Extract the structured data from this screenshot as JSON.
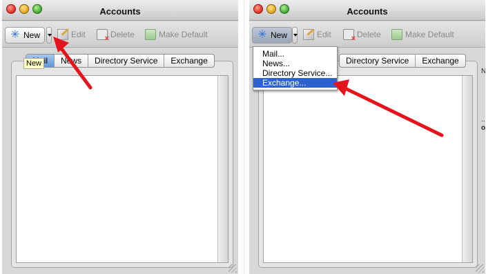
{
  "left": {
    "window_title": "Accounts",
    "toolbar": {
      "new": "New",
      "edit": "Edit",
      "delete": "Delete",
      "make_default": "Make Default"
    },
    "tabs": [
      "Mail",
      "News",
      "Directory Service",
      "Exchange"
    ],
    "tooltip": "New"
  },
  "right": {
    "window_title": "Accounts",
    "toolbar": {
      "new": "New",
      "edit": "Edit",
      "delete": "Delete",
      "make_default": "Make Default"
    },
    "tabs": [
      "Directory Service",
      "Exchange"
    ],
    "new_menu": {
      "items": [
        "Mail...",
        "News...",
        "Directory Service...",
        "Exchange..."
      ],
      "selected": "Exchange..."
    },
    "background_window_fragments": [
      "Ne",
      "...",
      "of"
    ]
  },
  "colors": {
    "annotation_arrow": "#e3141b",
    "menu_highlight": "#2e63cf",
    "tab_active": "#5f97dc",
    "tooltip_bg": "#ffffc6"
  },
  "icons": {
    "new": "new-account-star-icon",
    "edit": "edit-pencil-icon",
    "delete": "delete-trash-icon",
    "make_default": "make-default-icon"
  }
}
